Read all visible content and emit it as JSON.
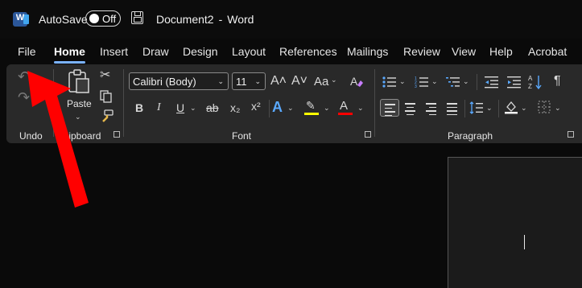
{
  "titlebar": {
    "app_logo": "W",
    "autosave_label": "AutoSave",
    "autosave_state": "Off",
    "document_name": "Document2",
    "separator": "-",
    "app_name": "Word"
  },
  "menu": {
    "tabs": [
      "File",
      "Home",
      "Insert",
      "Draw",
      "Design",
      "Layout",
      "References",
      "Mailings",
      "Review",
      "View",
      "Help",
      "Acrobat"
    ],
    "active": "Home"
  },
  "ribbon": {
    "undo": {
      "label": "Undo"
    },
    "clipboard": {
      "label": "Clipboard",
      "paste_label": "Paste"
    },
    "font": {
      "label": "Font",
      "font_name": "Calibri (Body)",
      "font_size": "11",
      "grow": "A˄",
      "shrink": "A˅",
      "case": "Aa",
      "bold": "B",
      "italic": "I",
      "underline": "U",
      "strikethrough": "ab",
      "subscript": "x₂",
      "superscript": "x²",
      "text_effects": "A",
      "font_color_letter": "A",
      "highlight_color": "#ffff00",
      "font_color": "#ff0000"
    },
    "paragraph": {
      "label": "Paragraph",
      "pilcrow": "¶"
    }
  },
  "colors": {
    "accent_underline": "#7bb3ff",
    "annotation_arrow": "#ff0000",
    "word_blue": "#2b579a"
  }
}
